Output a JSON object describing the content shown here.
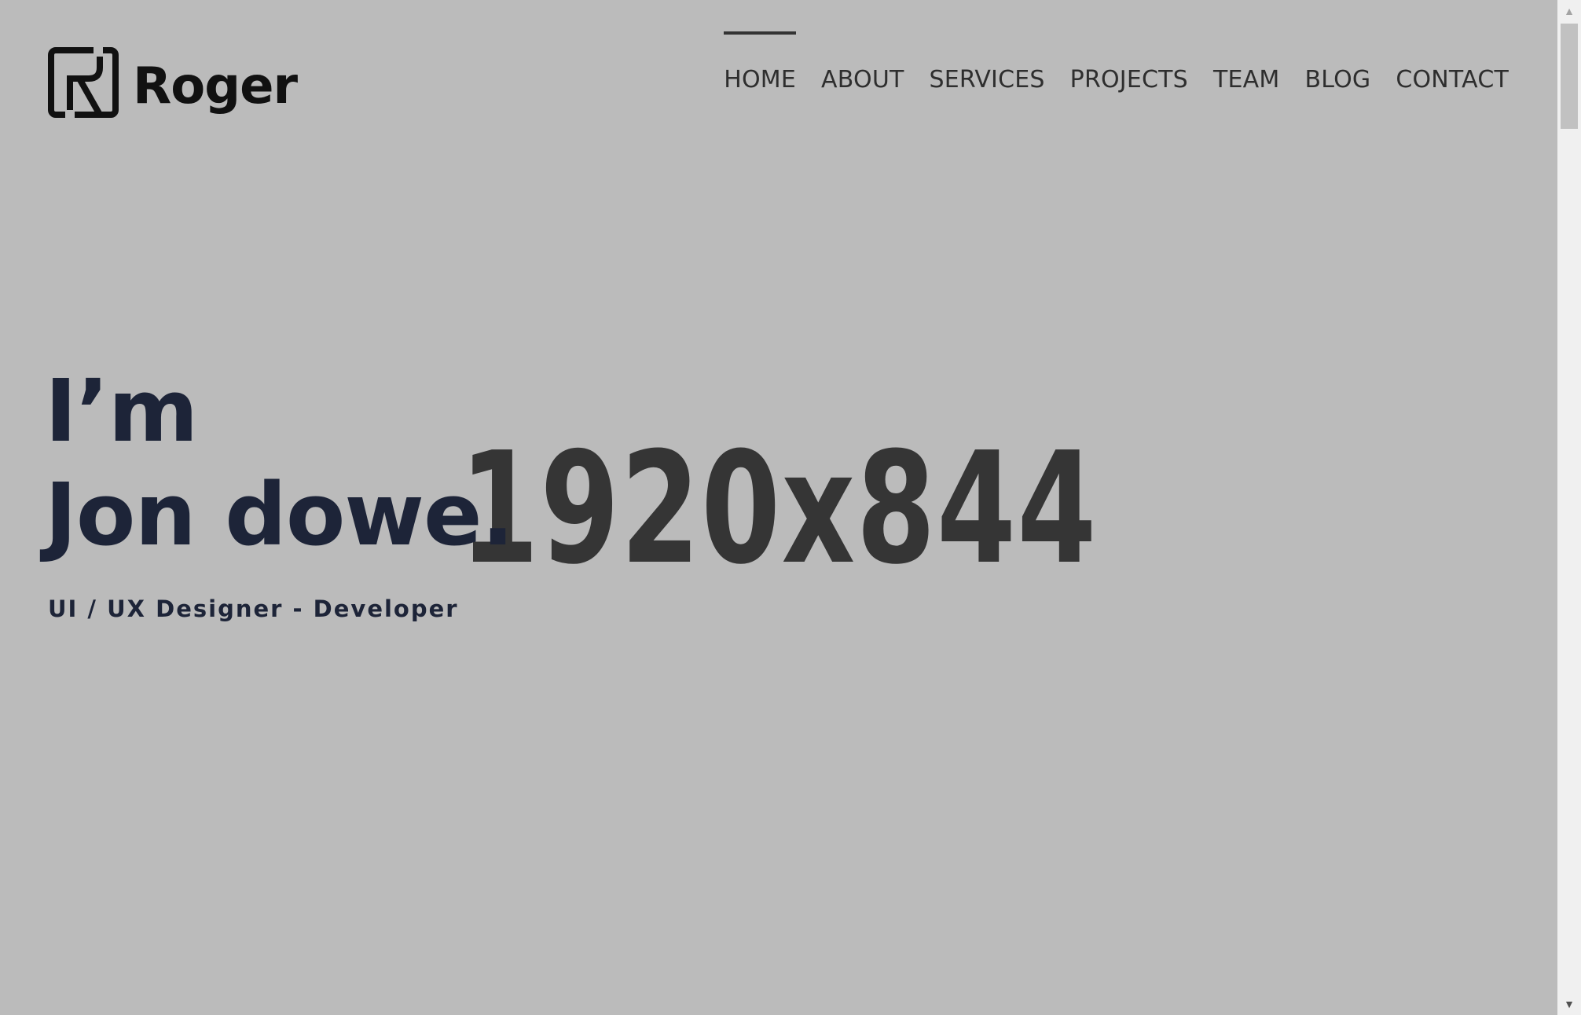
{
  "logo": {
    "text": "Roger",
    "icon": "r-logo-mark-icon"
  },
  "nav": {
    "items": [
      {
        "label": "HOME",
        "active": true
      },
      {
        "label": "ABOUT",
        "active": false
      },
      {
        "label": "SERVICES",
        "active": false
      },
      {
        "label": "PROJECTS",
        "active": false
      },
      {
        "label": "TEAM",
        "active": false
      },
      {
        "label": "BLOG",
        "active": false
      },
      {
        "label": "CONTACT",
        "active": false
      }
    ]
  },
  "hero": {
    "intro": "I’m",
    "name": "Jon dowe.",
    "role": "UI / UX Designer - Developer",
    "placeholder": "1920x844"
  },
  "colors": {
    "background": "#bbbbbb",
    "heading": "#1d2438",
    "nav_text": "#2e2e2e",
    "placeholder_text": "#353535"
  },
  "scrollbar": {
    "up_icon": "scroll-up-arrow-icon",
    "down_icon": "scroll-down-arrow-icon"
  }
}
